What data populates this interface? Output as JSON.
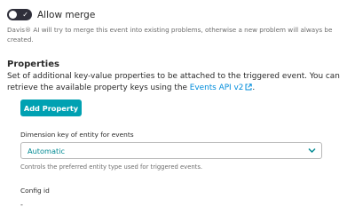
{
  "merge": {
    "label": "Allow merge",
    "enabled": true,
    "help": "Davis® AI will try to merge this event into existing problems, otherwise a new problem will always be created."
  },
  "properties": {
    "title": "Properties",
    "description": "Set of additional key-value properties to be attached to the triggered event. You can retrieve the available property keys using the ",
    "link_text": "Events API v2",
    "description_end": ".",
    "add_button": "Add Property"
  },
  "dimension": {
    "label": "Dimension key of entity for events",
    "value": "Automatic",
    "help": "Controls the preferred entity type used for triggered events."
  },
  "config": {
    "label": "Config id",
    "value": "-"
  },
  "colors": {
    "accent": "#00a1b2",
    "link": "#008cdb",
    "toggle_on": "#2f2f3a"
  }
}
